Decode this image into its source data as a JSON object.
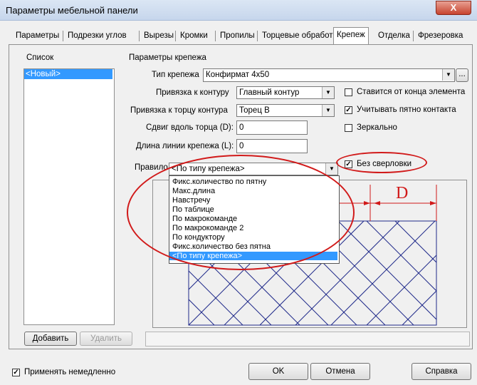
{
  "window": {
    "title": "Параметры мебельной панели",
    "close_label": "X"
  },
  "tabs": [
    "Параметры",
    "Подрезки углов",
    "Вырезы",
    "Кромки",
    "Пропилы",
    "Торцевые обработки",
    "Крепеж",
    "Отделка",
    "Фрезеровка"
  ],
  "list": {
    "header": "Список",
    "items": [
      "<Новый>"
    ]
  },
  "params": {
    "header": "Параметры крепежа",
    "type_label": "Тип крепежа",
    "type_value": "Конфирмат 4x50",
    "more_label": "...",
    "contour_label": "Привязка к контуру",
    "contour_value": "Главный контур",
    "edge_label": "Привязка к торцу контура",
    "edge_value": "Торец B",
    "shift_label": "Сдвиг вдоль торца (D):",
    "shift_value": "0",
    "length_label": "Длина линии крепежа (L):",
    "length_value": "0",
    "rule_label": "Правило",
    "rule_value": "<По типу крепежа>"
  },
  "checks": {
    "from_end": {
      "label": "Ставится от конца элемента",
      "checked": false
    },
    "contact": {
      "label": "Учитывать пятно контакта",
      "checked": true
    },
    "mirror": {
      "label": "Зеркально",
      "checked": false
    },
    "no_drill": {
      "label": "Без сверловки",
      "checked": true
    }
  },
  "dropdown_options": [
    "Фикс.количество по пятну",
    "Макс.длина",
    "Навстречу",
    "По таблице",
    "По макрокоманде",
    "По макрокоманде 2",
    "По кондуктору",
    "Фикс.количество без пятна",
    "<По типу крепежа>"
  ],
  "diagram": {
    "dimension_label": "D"
  },
  "buttons": {
    "add": "Добавить",
    "delete": "Удалить",
    "ok": "OK",
    "cancel": "Отмена",
    "help": "Справка"
  },
  "apply_now": {
    "label": "Применять немедленно",
    "checked": true
  },
  "colors": {
    "annotation": "#d11a1a",
    "selection": "#3399ff",
    "diagram": "#1f2a8a"
  }
}
